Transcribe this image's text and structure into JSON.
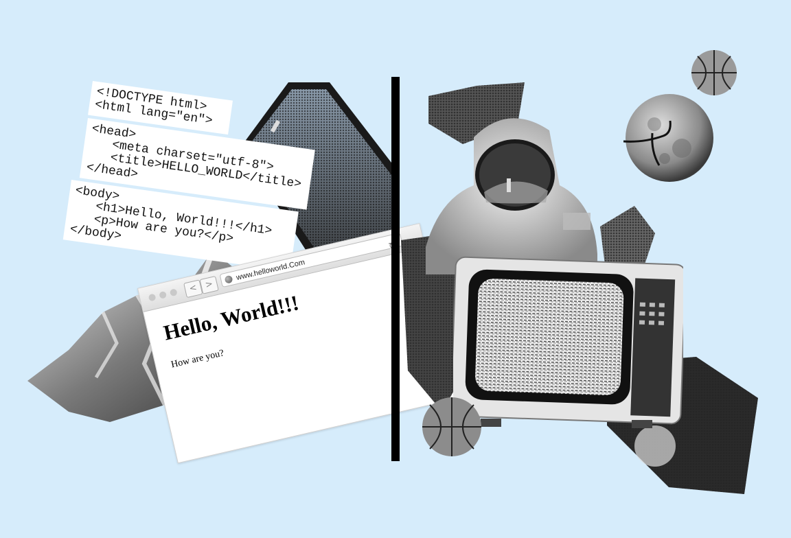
{
  "code_snippets": {
    "block1": "<!DOCTYPE html>\n<html lang=\"en\">",
    "block2": "<head>\n   <meta charset=\"utf-8\">\n   <title>HELLO_WORLD</title>\n</head>",
    "block3": "<body>\n   <h1>Hello, World!!!</h1>\n   <p>How are you?</p>\n</body>"
  },
  "browser": {
    "url": "www.helloworld.Com",
    "back_glyph": "<",
    "forward_glyph": ">",
    "reload_glyph": "↻",
    "heading": "Hello, World!!!",
    "paragraph": "How are you?"
  },
  "colors": {
    "background": "#d6ecfb",
    "divider": "#000000"
  },
  "icons": [
    "globe-icon",
    "reload-icon",
    "back-arrow-icon",
    "forward-arrow-icon"
  ]
}
